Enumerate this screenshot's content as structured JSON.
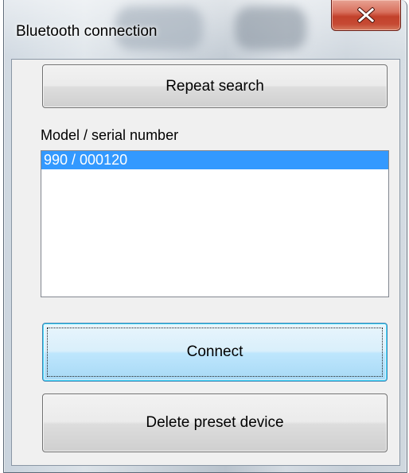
{
  "window": {
    "title": "Bluetooth connection",
    "close_icon": "close-icon"
  },
  "buttons": {
    "repeat_search": "Repeat search",
    "connect": "Connect",
    "delete_preset": "Delete preset device"
  },
  "device_list": {
    "label": "Model / serial number",
    "items": [
      {
        "text": "990 / 000120",
        "selected": true
      }
    ]
  },
  "colors": {
    "selection": "#3399ff",
    "close_button": "#c2412b",
    "default_button": "#bee6fd"
  }
}
